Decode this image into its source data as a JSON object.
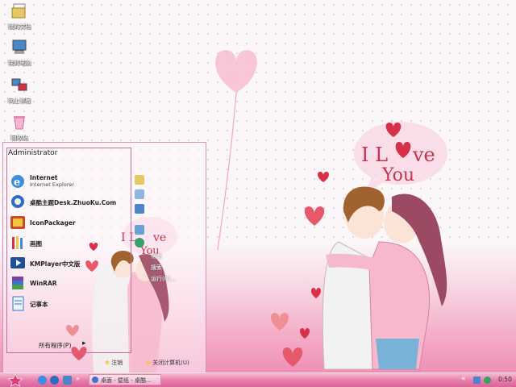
{
  "desktop": {
    "icons": [
      {
        "label": "我的文档",
        "icon": "my-documents-icon"
      },
      {
        "label": "我的电脑",
        "icon": "my-computer-icon"
      },
      {
        "label": "网上邻居",
        "icon": "network-places-icon"
      },
      {
        "label": "回收站",
        "icon": "recycle-bin-icon"
      }
    ],
    "wallpaper": {
      "bubble_text_1": "I L",
      "bubble_text_2": "ve",
      "bubble_text_3": "You",
      "colors": {
        "pink": "#ee8fb6",
        "heart_red": "#d9304a",
        "bubble": "#f9dde8"
      }
    }
  },
  "start_menu": {
    "user": "Administrator",
    "items": [
      {
        "title": "Internet",
        "subtitle": "Internet Explorer",
        "icon": "internet-explorer-icon"
      },
      {
        "title": "桌酷主题Desk.ZhuoKu.Com",
        "icon": "zhuoku-theme-icon"
      },
      {
        "title": "IconPackager",
        "icon": "iconpackager-icon"
      },
      {
        "title": "画图",
        "icon": "paint-icon"
      },
      {
        "title": "KMPlayer中文版",
        "icon": "kmplayer-icon"
      },
      {
        "title": "WinRAR",
        "icon": "winrar-icon"
      },
      {
        "title": "记事本",
        "icon": "notepad-icon"
      }
    ],
    "all_programs": "所有程序(P)",
    "right": {
      "run": "运行(R)...",
      "search": "搜索",
      "help": "帮助"
    },
    "logoff": "注销",
    "shutdown": "关闭计算机(U)",
    "overlay_text_1": "I L",
    "overlay_text_2": "ve",
    "overlay_text_3": "You"
  },
  "taskbar": {
    "task_button_label": "桌面 - 壁纸 - 桌酷...",
    "clock": "0:50"
  }
}
